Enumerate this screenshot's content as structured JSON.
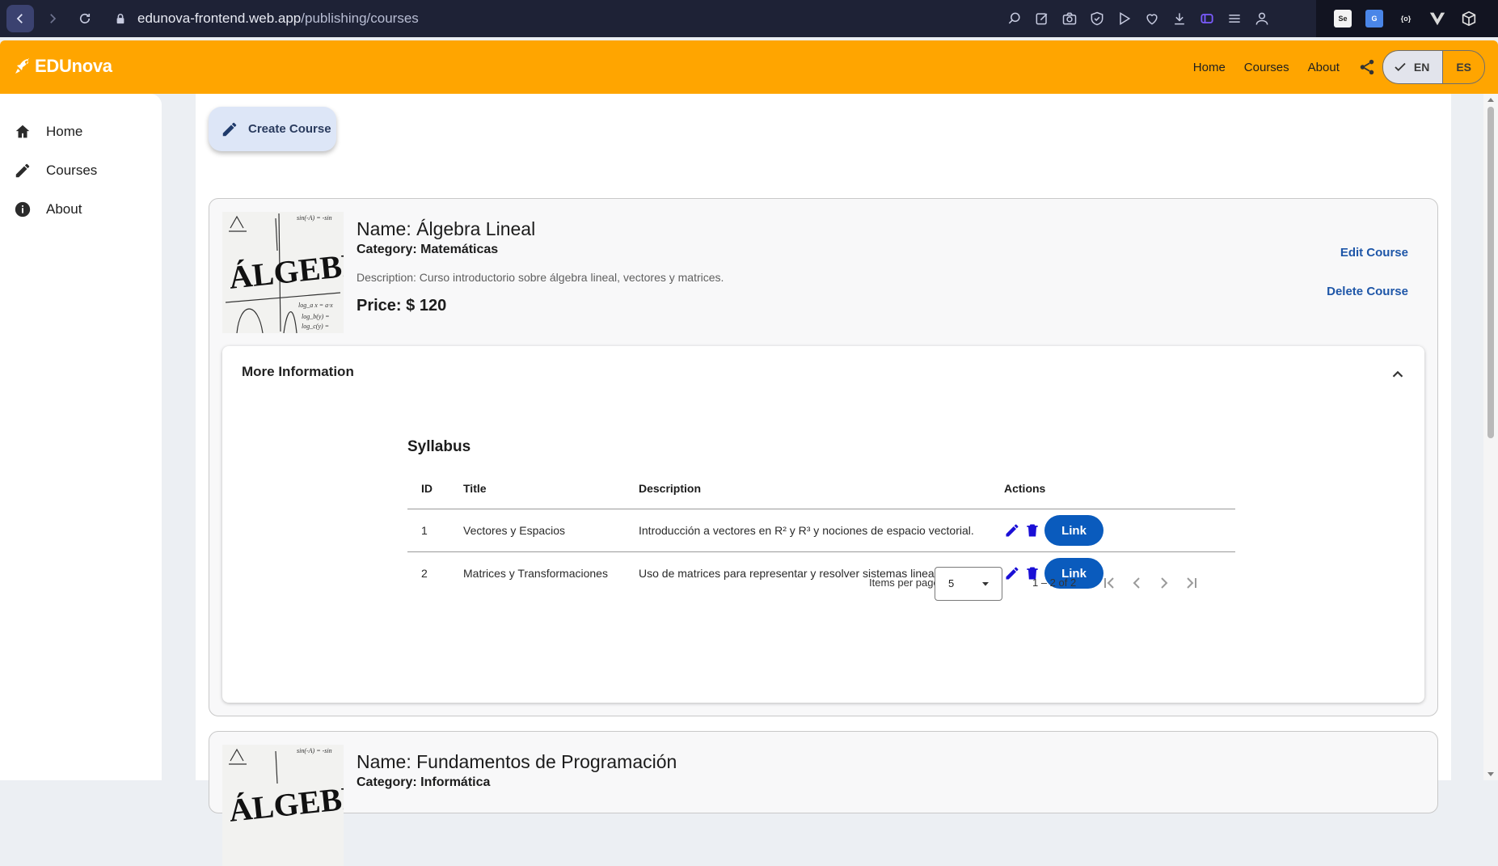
{
  "browser": {
    "url_host": "edunova-frontend.web.app",
    "url_path": "/publishing/courses"
  },
  "app": {
    "brand": "EDUnova",
    "nav": [
      "Home",
      "Courses",
      "About"
    ],
    "languages": [
      "EN",
      "ES"
    ],
    "selected_language": "EN",
    "accent_color": "#ffa500"
  },
  "sidebar": {
    "items": [
      {
        "label": "Home",
        "icon": "home-icon"
      },
      {
        "label": "Courses",
        "icon": "pencil-icon"
      },
      {
        "label": "About",
        "icon": "info-icon"
      }
    ]
  },
  "main": {
    "create_label": "Create Course",
    "courses": [
      {
        "name": "Name: Álgebra Lineal",
        "category_label": "Category:",
        "category": "Matemáticas",
        "description": "Description: Curso introductorio sobre álgebra lineal, vectores y matrices.",
        "price": "Price: $ 120",
        "edit_label": "Edit Course",
        "delete_label": "Delete Course",
        "thumb_text": "ÁLGEBRA",
        "more_info": "More Information",
        "syllabus_title": "Syllabus",
        "columns": [
          "ID",
          "Title",
          "Description",
          "Actions"
        ],
        "rows": [
          {
            "id": "1",
            "title": "Vectores y Espacios",
            "description": "Introducción a vectores en R² y R³ y nociones de espacio vectorial.",
            "link": "Link"
          },
          {
            "id": "2",
            "title": "Matrices y Transformaciones",
            "description": "Uso de matrices para representar y resolver sistemas lineales.",
            "link": "Link"
          }
        ],
        "paginator": {
          "items_per_page_label": "Items per page:",
          "page_size": "5",
          "range": "1 – 2 of 2"
        }
      },
      {
        "name": "Name: Fundamentos de Programación",
        "category_label": "Category:",
        "category": "Informática",
        "thumb_text": "ÁLGEBRA"
      }
    ]
  }
}
